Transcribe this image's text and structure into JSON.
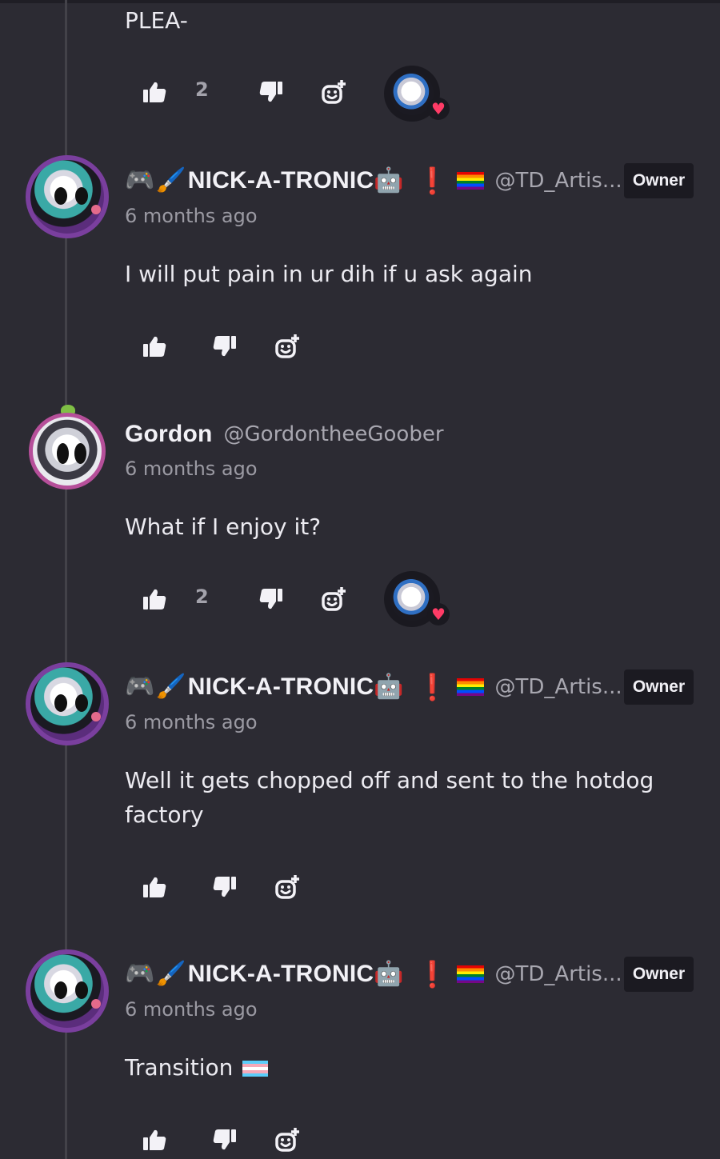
{
  "comments": [
    {
      "text": "PLEA-",
      "likes": "2"
    },
    {
      "username": "NICK-A-TRONIC",
      "handle": "@TD_Artis...",
      "badge": "Owner",
      "time": "6 months ago",
      "text": "I will put pain in ur dih if u ask again"
    },
    {
      "username": "Gordon",
      "handle": "@GordontheeGoober",
      "time": "6 months ago",
      "text": "What if I enjoy it?",
      "likes": "2"
    },
    {
      "username": "NICK-A-TRONIC",
      "handle": "@TD_Artis...",
      "badge": "Owner",
      "time": "6 months ago",
      "text": "Well it gets chopped off and sent to the hotdog factory"
    },
    {
      "username": "NICK-A-TRONIC",
      "handle": "@TD_Artis...",
      "badge": "Owner",
      "time": "6 months ago",
      "text": "Transition"
    }
  ],
  "icons": {
    "like": "thumbs-up-icon",
    "dislike": "thumbs-down-icon",
    "react": "add-reaction-icon",
    "heart": "heart-icon"
  },
  "emojis": {
    "gamepad": "🎮",
    "brush": "🖌️",
    "robot": "🤖",
    "exclaim": "❗"
  },
  "colors": {
    "background": "#2c2b33",
    "badge_bg": "#1b1a21",
    "heart": "#ff3b66"
  }
}
